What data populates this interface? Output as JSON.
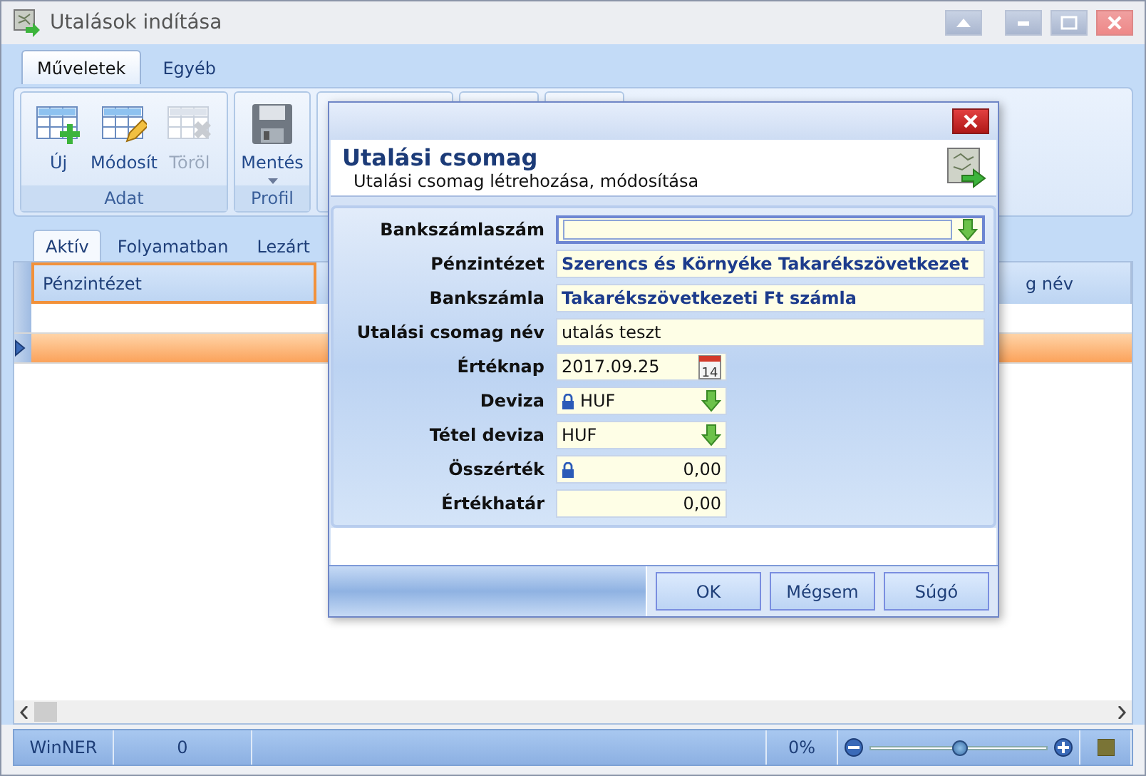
{
  "window": {
    "title": "Utalások indítása"
  },
  "ribbon_tabs": [
    {
      "label": "Műveletek",
      "selected": true
    },
    {
      "label": "Egyéb",
      "selected": false
    }
  ],
  "ribbon_groups": [
    {
      "label": "Adat",
      "buttons": [
        {
          "label": "Új",
          "kind": "add",
          "disabled": false,
          "dropdown": false
        },
        {
          "label": "Módosít",
          "kind": "edit",
          "disabled": false,
          "dropdown": false
        },
        {
          "label": "Töröl",
          "kind": "delete",
          "disabled": true,
          "dropdown": false
        }
      ]
    },
    {
      "label": "Profil",
      "buttons": [
        {
          "label": "Mentés",
          "kind": "save",
          "disabled": false,
          "dropdown": true
        }
      ]
    }
  ],
  "list_tabs": [
    {
      "label": "Aktív",
      "selected": true
    },
    {
      "label": "Folyamatban",
      "selected": false
    },
    {
      "label": "Lezárt",
      "selected": false
    }
  ],
  "table": {
    "columns": [
      "Pénzintézet",
      "g név"
    ],
    "rows": [
      {
        "selected": false
      },
      {
        "selected": true
      }
    ]
  },
  "status_bar": {
    "app": "WinNER",
    "count": "0",
    "zoom": "0%",
    "level": 0.5
  },
  "dialog": {
    "title": "Utalási csomag",
    "subtitle": "Utalási csomag létrehozása, módosítása",
    "fields": [
      {
        "label": "Bankszámlaszám",
        "kind": "lookup",
        "focused": true,
        "locked": false
      },
      {
        "label": "Pénzintézet",
        "kind": "text",
        "value": "Szerencs és Környéke Takarékszövetkezet",
        "focused": false,
        "locked": false,
        "readonly": true
      },
      {
        "label": "Bankszámla",
        "kind": "text",
        "value": "Takarékszövetkezeti Ft számla",
        "focused": false,
        "locked": false,
        "readonly": true
      },
      {
        "label": "Utalási csomag név",
        "kind": "text",
        "value": "utalás teszt",
        "focused": false,
        "locked": false,
        "readonly": false
      },
      {
        "label": "Értéknap",
        "kind": "date",
        "value": "2017.09.25",
        "day": "14",
        "focused": false,
        "locked": false,
        "readonly": false
      },
      {
        "label": "Deviza",
        "kind": "dropdown",
        "value": "HUF",
        "focused": false,
        "locked": true,
        "readonly": false
      },
      {
        "label": "Tétel deviza",
        "kind": "dropdown",
        "value": "HUF",
        "focused": false,
        "locked": false,
        "readonly": false
      },
      {
        "label": "Összérték",
        "kind": "amount",
        "value": "0,00",
        "focused": false,
        "locked": true,
        "readonly": false
      },
      {
        "label": "Értékhatár",
        "kind": "amount",
        "value": "0,00",
        "focused": false,
        "locked": false,
        "readonly": false
      }
    ],
    "buttons": [
      "OK",
      "Mégsem",
      "Súgó"
    ]
  }
}
